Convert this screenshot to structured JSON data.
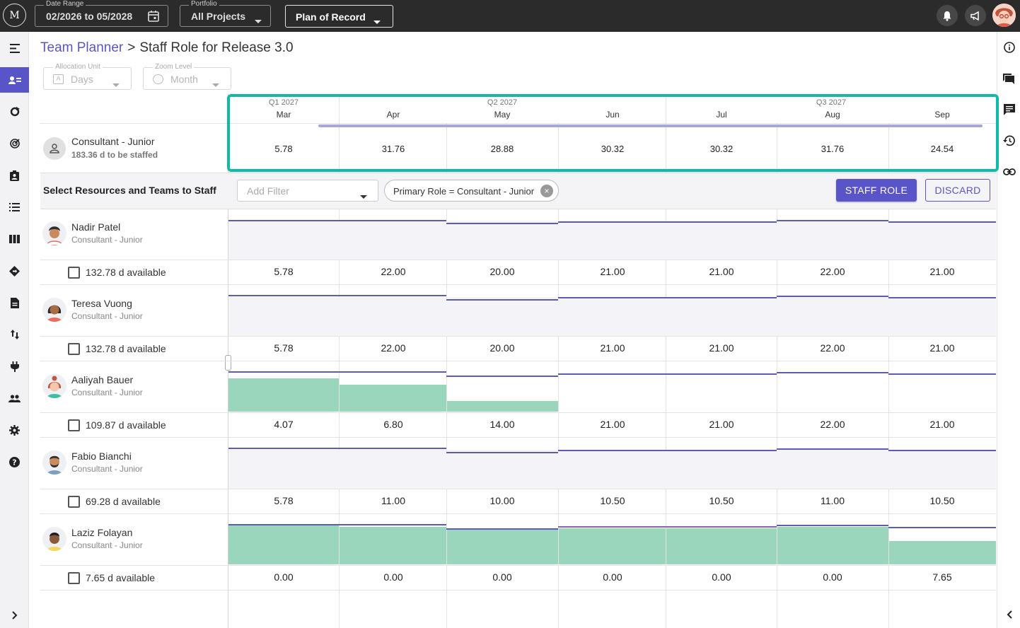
{
  "topbar": {
    "logo_text": "M",
    "date_range": {
      "label": "Date Range",
      "value": "02/2026 to 05/2028"
    },
    "portfolio": {
      "label": "Portfolio",
      "value": "All Projects"
    },
    "plan": {
      "value": "Plan of Record"
    }
  },
  "breadcrumb": {
    "parent": "Team Planner",
    "separator": ">",
    "current": "Staff Role for Release 3.0"
  },
  "controls": {
    "allocation_unit": {
      "label": "Allocation Unit",
      "value": "Days"
    },
    "zoom_level": {
      "label": "Zoom Level",
      "value": "Month"
    }
  },
  "timeline": {
    "quarters": [
      "Q1 2027",
      "Q2 2027",
      "Q3 2027"
    ],
    "months": [
      "Mar",
      "Apr",
      "May",
      "Jun",
      "Jul",
      "Aug",
      "Sep"
    ]
  },
  "role": {
    "name": "Consultant - Junior",
    "to_be_staffed": "183.36 d to be staffed",
    "demand": [
      "5.78",
      "31.76",
      "28.88",
      "30.32",
      "30.32",
      "31.76",
      "24.54"
    ]
  },
  "filterbar": {
    "title": "Select Resources and Teams to Staff",
    "add_filter_placeholder": "Add Filter",
    "chip": "Primary Role = Consultant - Junior",
    "staff_button": "STAFF ROLE",
    "discard_button": "DISCARD"
  },
  "resources": [
    {
      "name": "Nadir Patel",
      "role": "Consultant - Junior",
      "available": "132.78 d available",
      "values": [
        "5.78",
        "22.00",
        "20.00",
        "21.00",
        "21.00",
        "22.00",
        "21.00"
      ]
    },
    {
      "name": "Teresa Vuong",
      "role": "Consultant - Junior",
      "available": "132.78 d available",
      "values": [
        "5.78",
        "22.00",
        "20.00",
        "21.00",
        "21.00",
        "22.00",
        "21.00"
      ]
    },
    {
      "name": "Aaliyah Bauer",
      "role": "Consultant - Junior",
      "available": "109.87 d available",
      "values": [
        "4.07",
        "6.80",
        "14.00",
        "21.00",
        "21.00",
        "22.00",
        "21.00"
      ]
    },
    {
      "name": "Fabio Bianchi",
      "role": "Consultant - Junior",
      "available": "69.28 d available",
      "values": [
        "5.78",
        "11.00",
        "10.00",
        "10.50",
        "10.50",
        "11.00",
        "10.50"
      ]
    },
    {
      "name": "Laziz Folayan",
      "role": "Consultant - Junior",
      "available": "7.65 d available",
      "values": [
        "0.00",
        "0.00",
        "0.00",
        "0.00",
        "0.00",
        "0.00",
        "7.65"
      ]
    }
  ],
  "colors": {
    "accent": "#5955c9",
    "highlight": "#10b9aa",
    "booked": "#9ad6bb",
    "capacity": "#5c5cb8"
  },
  "icons": {
    "left_rail": [
      "menu-icon",
      "staff-role-icon",
      "refresh-icon",
      "target-icon",
      "badge-icon",
      "list-icon",
      "columns-icon",
      "diamond-icon",
      "document-icon",
      "transfer-icon",
      "plug-icon",
      "people-icon",
      "gear-icon",
      "help-icon",
      "expand-icon"
    ],
    "right_rail": [
      "info-icon",
      "chat-icon",
      "comment-icon",
      "history-icon",
      "link-icon",
      "collapse-icon"
    ]
  }
}
